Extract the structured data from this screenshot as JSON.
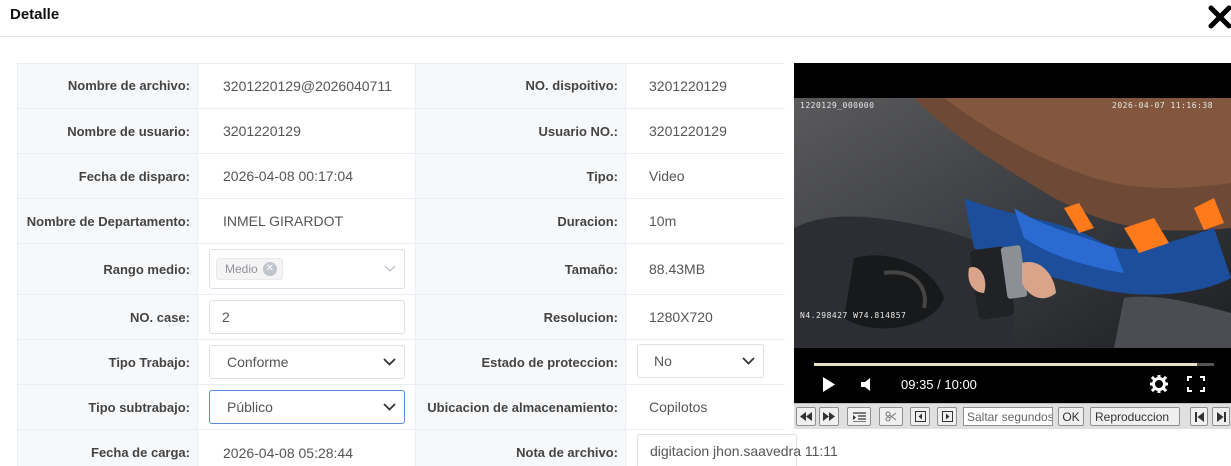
{
  "header": {
    "title": "Detalle"
  },
  "form": {
    "file_name": {
      "label": "Nombre de archivo:",
      "value": "3201220129@2026040711"
    },
    "device_no": {
      "label": "NO. dispoitivo:",
      "value": "3201220129"
    },
    "user_name": {
      "label": "Nombre de usuario:",
      "value": "3201220129"
    },
    "user_no": {
      "label": "Usuario NO.:",
      "value": "3201220129"
    },
    "trigger_date": {
      "label": "Fecha de disparo:",
      "value": "2026-04-08 00:17:04"
    },
    "type": {
      "label": "Tipo:",
      "value": "Video"
    },
    "department": {
      "label": "Nombre de Departamento:",
      "value": "INMEL GIRARDOT"
    },
    "duration": {
      "label": "Duracion:",
      "value": "10m"
    },
    "range": {
      "label": "Rango medio:",
      "tag": "Medio"
    },
    "size": {
      "label": "Tamaño:",
      "value": "88.43MB"
    },
    "case_no": {
      "label": "NO. case:",
      "value": "2"
    },
    "resolution": {
      "label": "Resolucion:",
      "value": "1280X720"
    },
    "work_type": {
      "label": "Tipo Trabajo:",
      "value": "Conforme"
    },
    "protection": {
      "label": "Estado de proteccion:",
      "value": "No"
    },
    "sub_work_type": {
      "label": "Tipo subtrabajo:",
      "value": "Público"
    },
    "storage": {
      "label": "Ubicacion de almacenamiento:",
      "value": "Copilotos"
    },
    "upload_date": {
      "label": "Fecha de carga:",
      "value": "2026-04-08 05:28:44"
    },
    "note": {
      "label": "Nota de archivo:",
      "value": "digitacion jhon.saavedra 11:11"
    }
  },
  "player": {
    "osd_id": "1220129_000000",
    "osd_datetime": "2026-04-07 11:16:38",
    "osd_gps": "N4.298427 W74.814857",
    "time": "09:35 / 10:00",
    "progress": 0.958
  },
  "toolbar": {
    "seek_placeholder": "Saltar segundos",
    "ok_label": "OK",
    "playback_label": "Reproduccion"
  },
  "colors": {
    "accent_border": "#5b8bd8",
    "label_bg": "#f7f8fa"
  }
}
